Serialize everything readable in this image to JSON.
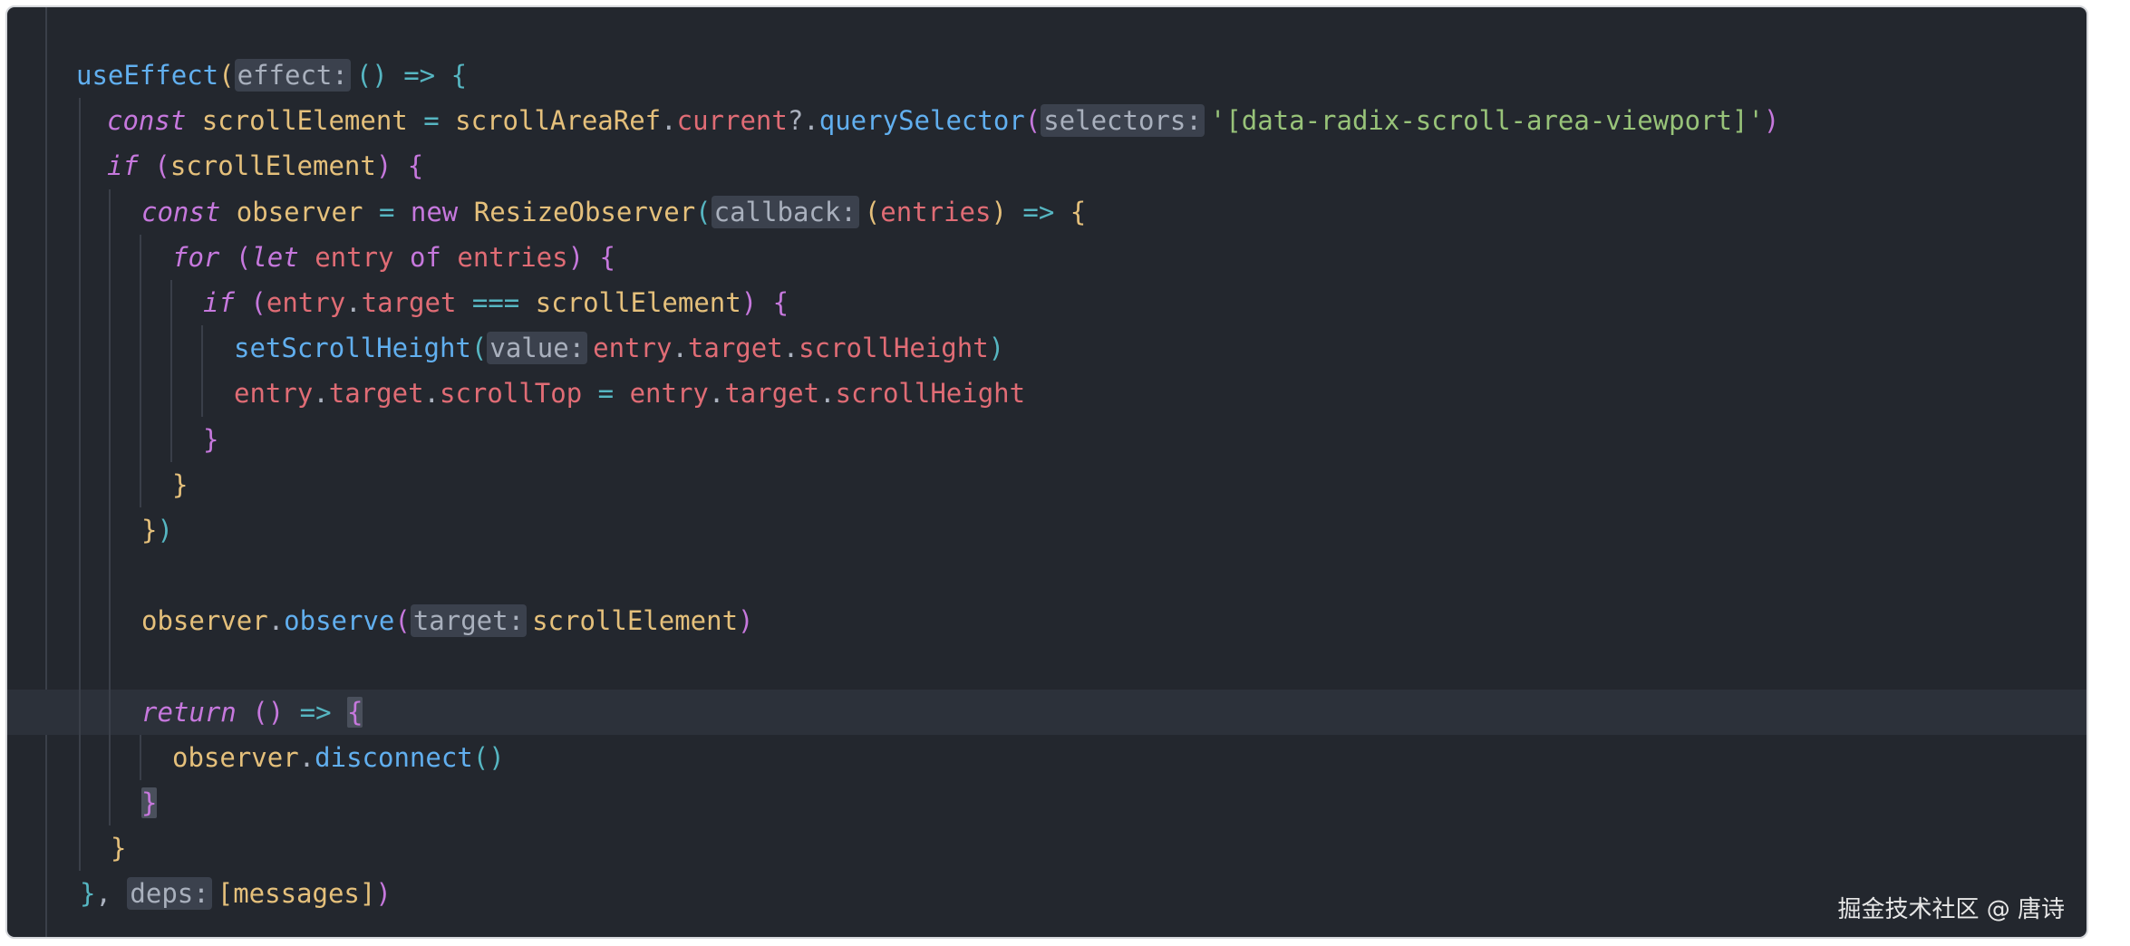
{
  "code": {
    "l1": {
      "fn": "useEffect",
      "open": "(",
      "hint": "effect:",
      "params": "()",
      "arrow": "=>",
      "brace": "{"
    },
    "l2": {
      "kw": "const",
      "name": "scrollElement",
      "eq": "=",
      "obj": "scrollAreaRef",
      "dot1": ".",
      "prop": "current",
      "opt": "?.",
      "method": "querySelector",
      "open": "(",
      "hint": "selectors:",
      "str": "'[data-radix-scroll-area-viewport]'",
      "close": ")"
    },
    "l3": {
      "kw": "if",
      "open": "(",
      "cond": "scrollElement",
      "close": ")",
      "brace": "{"
    },
    "l4": {
      "kw": "const",
      "name": "observer",
      "eq": "=",
      "new": "new",
      "cls": "ResizeObserver",
      "open": "(",
      "hint": "callback:",
      "popen": "(",
      "param": "entries",
      "pclose": ")",
      "arrow": "=>",
      "brace": "{"
    },
    "l5": {
      "kw": "for",
      "open": "(",
      "let": "let",
      "var": "entry",
      "of": "of",
      "iter": "entries",
      "close": ")",
      "brace": "{"
    },
    "l6": {
      "kw": "if",
      "open": "(",
      "obj": "entry",
      "dot": ".",
      "prop": "target",
      "eq": "===",
      "cmp": "scrollElement",
      "close": ")",
      "brace": "{"
    },
    "l7": {
      "fn": "setScrollHeight",
      "open": "(",
      "hint": "value:",
      "obj": "entry",
      "dot1": ".",
      "prop1": "target",
      "dot2": ".",
      "prop2": "scrollHeight",
      "close": ")"
    },
    "l8": {
      "obj": "entry",
      "dot1": ".",
      "prop1": "target",
      "dot2": ".",
      "prop2": "scrollTop",
      "eq": "=",
      "obj2": "entry",
      "dot3": ".",
      "prop3": "target",
      "dot4": ".",
      "prop4": "scrollHeight"
    },
    "l9": {
      "brace": "}"
    },
    "l10": {
      "brace": "}"
    },
    "l11": {
      "brace": "}",
      "paren": ")"
    },
    "l13": {
      "obj": "observer",
      "dot": ".",
      "method": "observe",
      "open": "(",
      "hint": "target:",
      "arg": "scrollElement",
      "close": ")"
    },
    "l15": {
      "kw": "return",
      "params": "()",
      "arrow": "=>",
      "brace": "{"
    },
    "l16": {
      "obj": "observer",
      "dot": ".",
      "method": "disconnect",
      "params": "()"
    },
    "l17": {
      "brace": "}"
    },
    "l18": {
      "brace": "}"
    },
    "l19": {
      "brace": "}",
      "comma": ",",
      "hint": "deps:",
      "open": "[",
      "dep": "messages",
      "close": "]",
      "paren": ")"
    }
  },
  "watermark": "掘金技术社区 @ 唐诗",
  "colors": {
    "background": "#23272e",
    "keyword": "#c678dd",
    "function": "#61afef",
    "variable": "#e5c07b",
    "property": "#e06c75",
    "string": "#98c379",
    "operator": "#56b6c2"
  }
}
